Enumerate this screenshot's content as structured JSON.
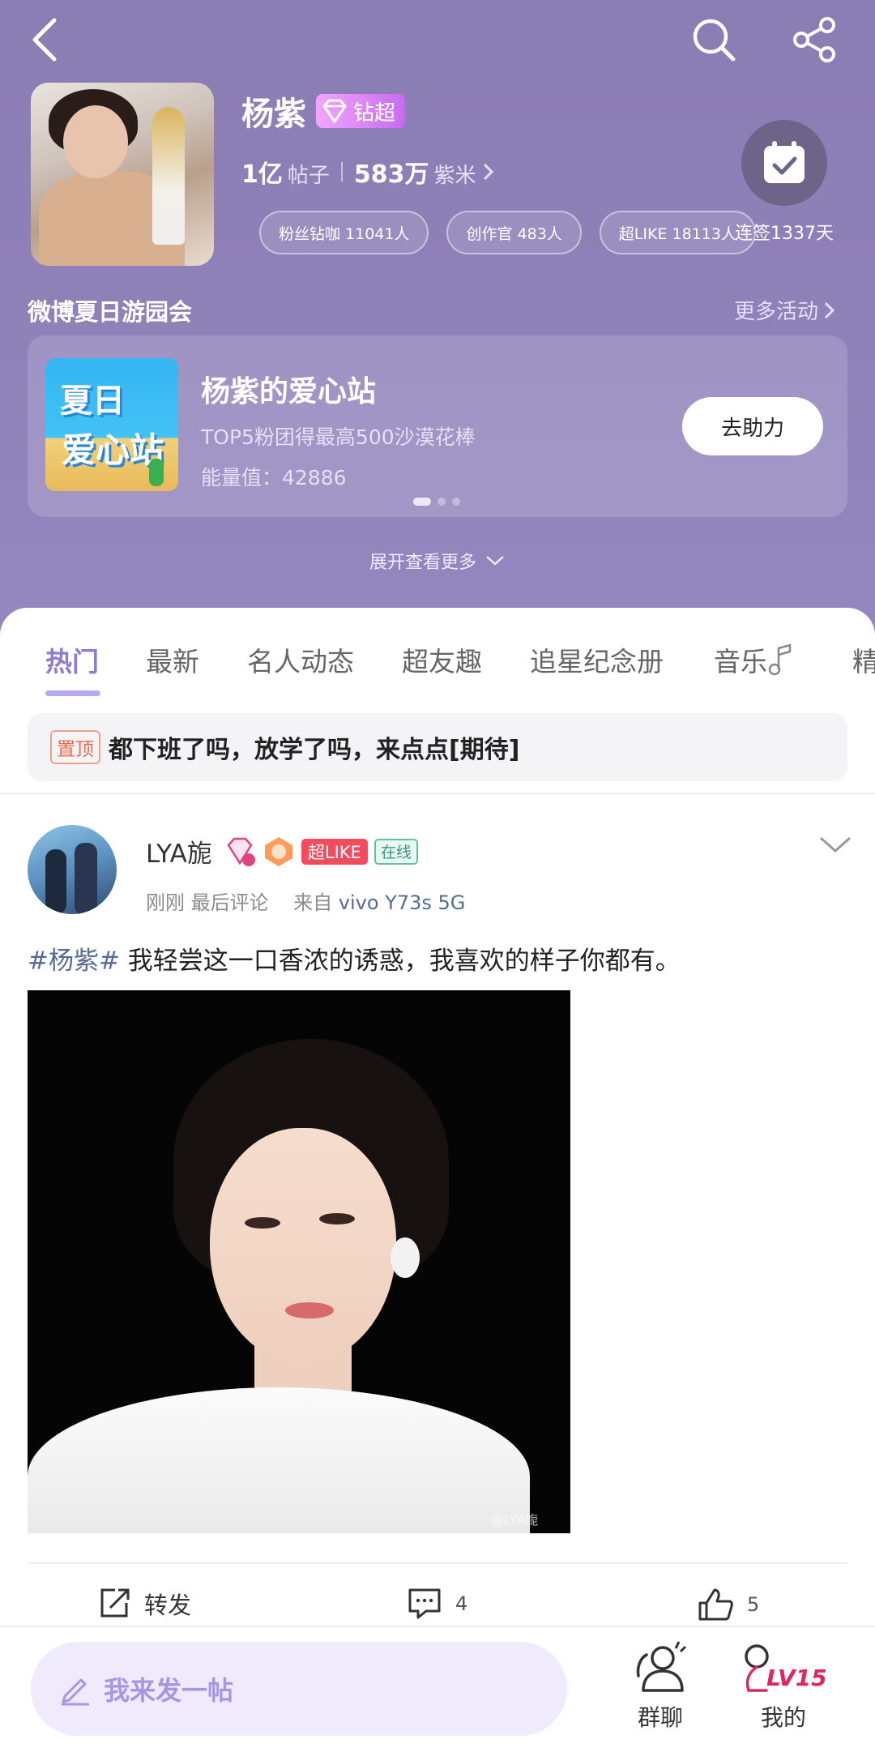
{
  "colors": {
    "header_purple": "#8e81b8",
    "accent": "#8d7cd3",
    "link_blue": "#576b95",
    "superlike_red": "#f24b5e"
  },
  "header": {
    "name": "杨紫",
    "badge_label": "钻超",
    "stats": [
      {
        "num": "1亿",
        "label": "帖子"
      },
      {
        "num": "583万",
        "label": "紫米"
      }
    ],
    "pills": [
      "粉丝钻咖 11041人",
      "创作官 483人",
      "超LIKE 18113人"
    ],
    "checkin_label": "连签1337天",
    "section_title": "微博夏日游园会",
    "section_more": "更多活动",
    "event": {
      "thumb_line1": "夏日",
      "thumb_line2": "爱心站",
      "title": "杨紫的爱心站",
      "subtitle": "TOP5粉团得最高500沙漠花棒",
      "energy": "能量值：42886",
      "button": "去助力"
    },
    "expand_label": "展开查看更多"
  },
  "tabs": [
    "热门",
    "最新",
    "名人动态",
    "超友趣",
    "追星纪念册",
    "音乐",
    "精"
  ],
  "pinned": {
    "tag": "置顶",
    "text": "都下班了吗，放学了吗，来点点[期待]"
  },
  "post": {
    "user": "LYA旎",
    "superlike": "超LIKE",
    "online": "在线",
    "time": "刚刚 最后评论",
    "source_prefix": "来自",
    "source": "vivo Y73s 5G",
    "hashtag": "#杨紫#",
    "text": " 我轻尝这一口香浓的诱惑，我喜欢的样子你都有。",
    "watermark": "@LYA旎",
    "actions": {
      "repost": "转发",
      "comments": "4",
      "likes": "5"
    }
  },
  "bottom": {
    "compose": "我来发一帖",
    "group_chat": "群聊",
    "mine": "我的",
    "level": "LV15"
  }
}
